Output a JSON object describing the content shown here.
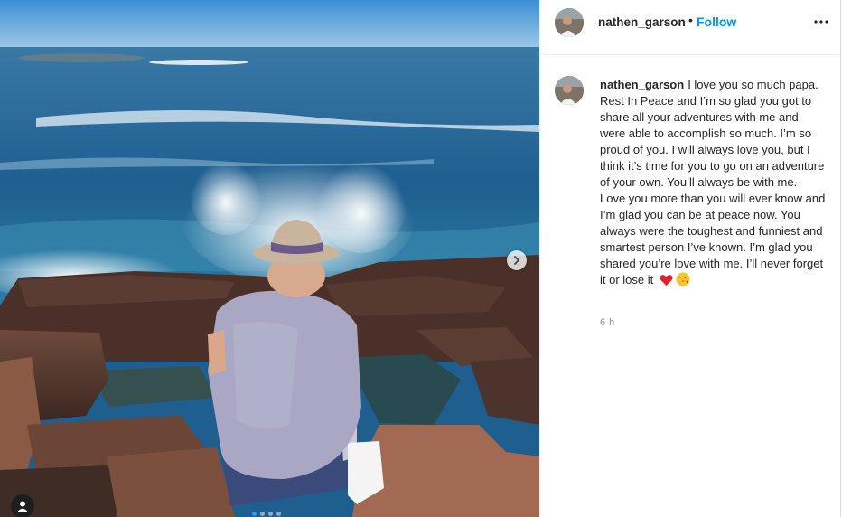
{
  "post": {
    "username": "nathen_garson",
    "separator": "•",
    "follow_label": "Follow",
    "more_icon": "ellipsis-icon",
    "caption": {
      "username": "nathen_garson",
      "text": "I love you so much papa. Rest In Peace and I’m so glad you got to share all your adventures with me and were able to accomplish so much. I’m so proud of you. I will always love you, but I think it’s time for you to go on an adventure of your own. You’ll always be with me. Love you more than you will ever know and I’m glad you can be at peace now. You always were the toughest and funniest and smartest person I’ve known. I’m glad you shared you’re love with me. I’ll never forget it or lose it",
      "emojis": [
        "red-heart-emoji",
        "face-blowing-kiss-emoji"
      ]
    },
    "timestamp": "6 h",
    "carousel": {
      "slide_count": 4,
      "active_index": 0
    },
    "colors": {
      "follow": "#0095f6",
      "active_dot": "#3897f0",
      "text": "#262626",
      "muted": "#8e8e8e"
    }
  }
}
